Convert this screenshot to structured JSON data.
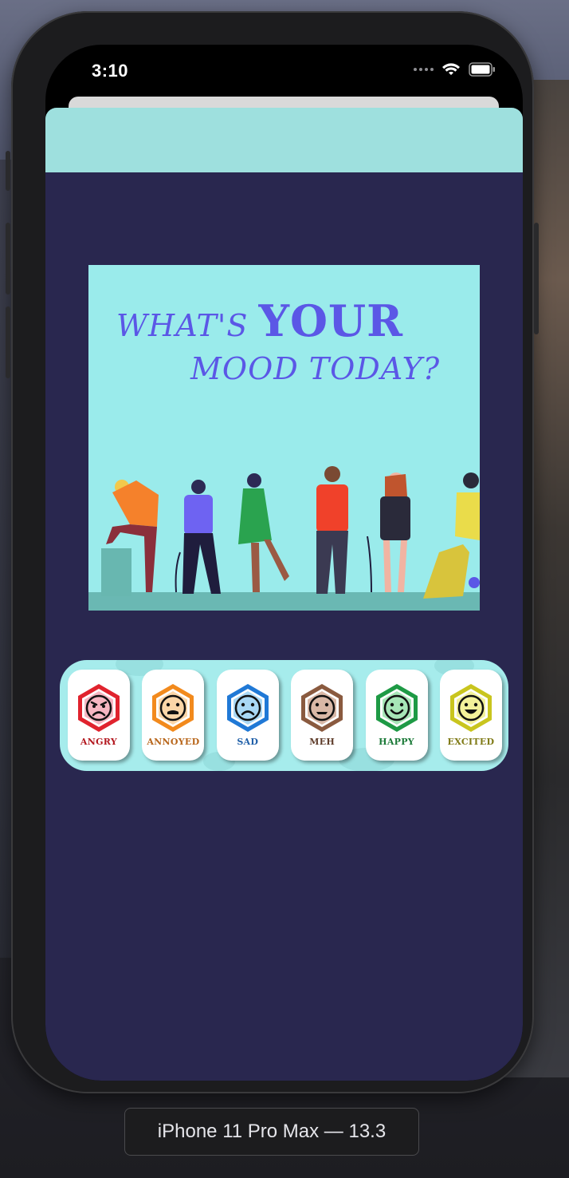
{
  "status_bar": {
    "time": "3:10"
  },
  "hero": {
    "line1_a": "WHAT'S ",
    "line1_b": "YOUR",
    "line2": "MOOD TODAY?"
  },
  "moods": [
    {
      "label": "ANGRY",
      "color": "#e0232e",
      "fill": "#f6b6c2",
      "text": "#b3181f",
      "face": "angry"
    },
    {
      "label": "ANNOYED",
      "color": "#f28a1d",
      "fill": "#fbd6a8",
      "text": "#b8661b",
      "face": "annoyed"
    },
    {
      "label": "SAD",
      "color": "#2079d6",
      "fill": "#a9d8f5",
      "text": "#1f5fa8",
      "face": "sad"
    },
    {
      "label": "MEH",
      "color": "#8a5a3f",
      "fill": "#d9b8a6",
      "text": "#5e3c2a",
      "face": "meh"
    },
    {
      "label": "HAPPY",
      "color": "#1e9a45",
      "fill": "#a7e6b7",
      "text": "#1b7a38",
      "face": "happy"
    },
    {
      "label": "EXCITED",
      "color": "#c9c51e",
      "fill": "#f3f19a",
      "text": "#7f7a16",
      "face": "excited"
    }
  ],
  "device_label": "iPhone 11 Pro Max — 13.3"
}
